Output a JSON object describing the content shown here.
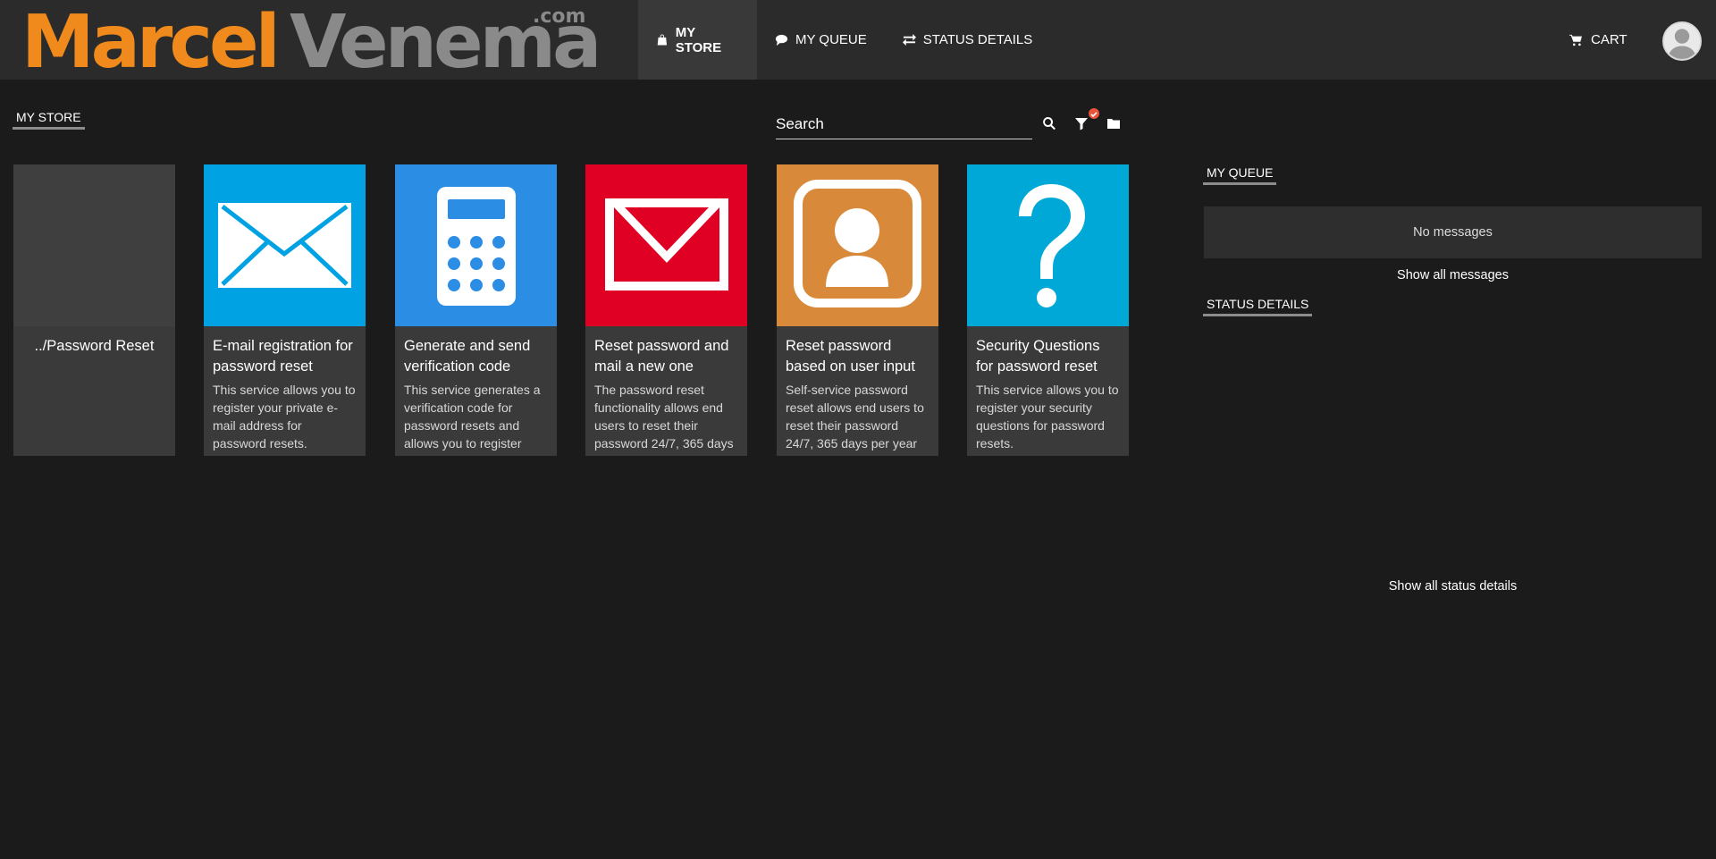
{
  "header": {
    "logo_main": "Marcel",
    "logo_secondary": "Venema",
    "logo_suffix": ".com",
    "nav": [
      {
        "label": "MY STORE",
        "icon": "shopping-bag-icon",
        "active": true
      },
      {
        "label": "MY QUEUE",
        "icon": "chat-bubble-icon",
        "active": false
      },
      {
        "label": "STATUS DETAILS",
        "icon": "exchange-arrows-icon",
        "active": false
      }
    ],
    "cart_label": "CART"
  },
  "store": {
    "section_label": "MY STORE",
    "search_placeholder": "Search",
    "tiles": [
      {
        "title": "../Password Reset",
        "description": "",
        "color": "#3f3f3f",
        "icon": "folder-tile"
      },
      {
        "title": "E-mail registration for password reset",
        "description": "This service allows you to register your private e-mail address for password resets.",
        "color": "#00a2e3",
        "icon": "envelope-icon"
      },
      {
        "title": "Generate and send verification code",
        "description": "This service generates a verification code for password resets and allows you to register",
        "color": "#2b8de3",
        "icon": "calculator-icon"
      },
      {
        "title": "Reset password and mail a new one",
        "description": "The password reset functionality allows end users to reset their password 24/7, 365 days",
        "color": "#e00024",
        "icon": "mail-icon"
      },
      {
        "title": "Reset password based on user input",
        "description": "Self-service password reset allows end users to reset their password 24/7, 365 days per year",
        "color": "#d8893a",
        "icon": "user-contact-icon"
      },
      {
        "title": "Security Questions for password reset",
        "description": "This service allows you to register your security questions for password resets.",
        "color": "#00a8d8",
        "icon": "question-mark-icon"
      }
    ]
  },
  "queue": {
    "section_label": "MY QUEUE",
    "empty_text": "No messages",
    "show_all": "Show all messages"
  },
  "status": {
    "section_label": "STATUS DETAILS",
    "show_all": "Show all status details"
  }
}
